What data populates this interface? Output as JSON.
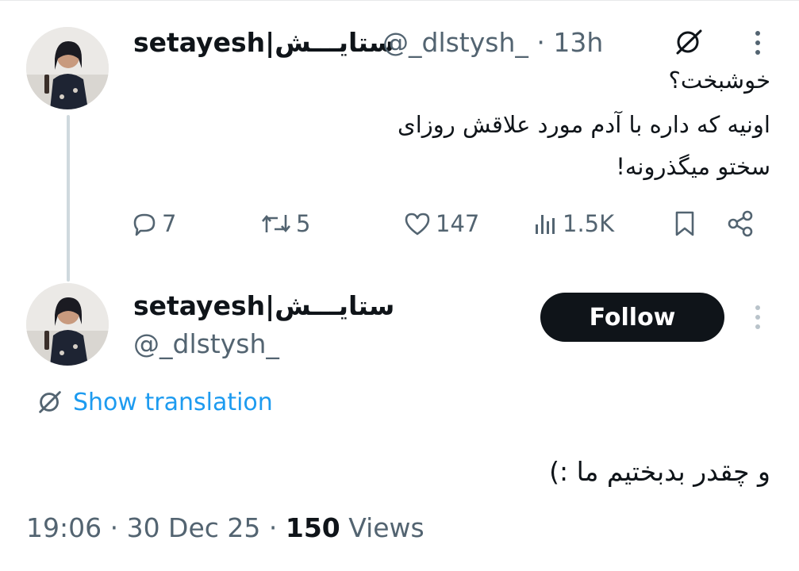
{
  "tweet": {
    "display_name": "setayesh|ستایـــش",
    "handle": "@_dlstysh_",
    "separator": "·",
    "time": "13h",
    "lines": [
      "خوشبخت؟",
      "اونیه که داره با آدم مورد علاقش روزای",
      "سختو میگذرونه!"
    ],
    "stats": {
      "replies": "7",
      "reposts": "5",
      "likes": "147",
      "views": "1.5K"
    }
  },
  "reply": {
    "display_name": "setayesh|ستایـــش",
    "handle": "@_dlstysh_",
    "follow_label": "Follow",
    "show_translation": "Show translation",
    "text": "و چقدر بدبختیم ما :)",
    "date_time": "19:06 · 30 Dec 25 · ",
    "views_count": "150",
    "views_label": " Views"
  },
  "colors": {
    "text": "#0f1419",
    "secondary": "#536471",
    "link": "#1d9bf0",
    "follow_bg": "#0f1419",
    "thread_line": "#cfd9de"
  },
  "icons": [
    "grok-icon",
    "more-icon",
    "reply-icon",
    "repost-icon",
    "like-icon",
    "views-icon",
    "bookmark-icon",
    "share-icon",
    "translate-icon"
  ]
}
